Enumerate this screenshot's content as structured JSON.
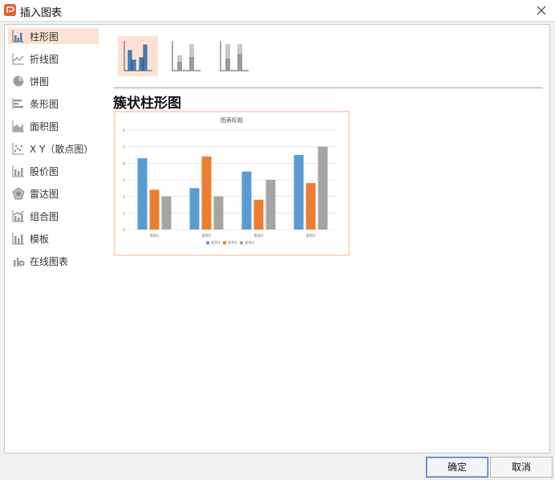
{
  "window": {
    "title": "插入图表"
  },
  "sidebar": {
    "items": [
      {
        "label": "柱形图",
        "icon": "column-chart-icon"
      },
      {
        "label": "折线图",
        "icon": "line-chart-icon"
      },
      {
        "label": "饼图",
        "icon": "pie-chart-icon"
      },
      {
        "label": "条形图",
        "icon": "bar-chart-icon"
      },
      {
        "label": "面积图",
        "icon": "area-chart-icon"
      },
      {
        "label": "X Y（散点图）",
        "icon": "scatter-chart-icon"
      },
      {
        "label": "股价图",
        "icon": "stock-chart-icon"
      },
      {
        "label": "雷达图",
        "icon": "radar-chart-icon"
      },
      {
        "label": "组合图",
        "icon": "combo-chart-icon"
      },
      {
        "label": "模板",
        "icon": "template-icon"
      },
      {
        "label": "在线图表",
        "icon": "online-chart-icon"
      }
    ],
    "selected": "柱形图"
  },
  "main": {
    "subtypes": [
      "clustered-column-icon",
      "stacked-column-icon",
      "percent-stacked-column-icon"
    ],
    "selected_subtype_name": "簇状柱形图"
  },
  "chart_data": {
    "type": "bar",
    "title": "图表标题",
    "categories": [
      "类别1",
      "类别2",
      "类别3",
      "类别4"
    ],
    "series": [
      {
        "name": "系列1",
        "values": [
          4.3,
          2.5,
          3.5,
          4.5
        ],
        "color": "#5b9bd5"
      },
      {
        "name": "系列2",
        "values": [
          2.4,
          4.4,
          1.8,
          2.8
        ],
        "color": "#ed7d31"
      },
      {
        "name": "系列3",
        "values": [
          2.0,
          2.0,
          3.0,
          5.0
        ],
        "color": "#a5a5a5"
      }
    ],
    "ylim": [
      0,
      6
    ],
    "yticks": [
      "0",
      "1",
      "2",
      "3",
      "4",
      "5",
      "6"
    ],
    "grid": true,
    "legend": "bottom"
  },
  "footer": {
    "ok_label": "确定",
    "cancel_label": "取消"
  }
}
